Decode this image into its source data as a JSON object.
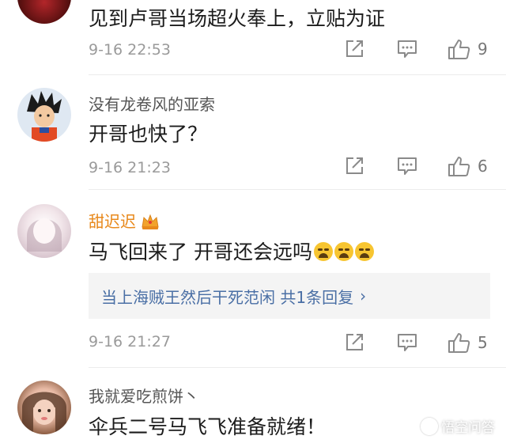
{
  "comments": [
    {
      "name": "",
      "text": "见到卢哥当场超火奉上，立贴为证",
      "time": "9-16 22:53",
      "like_count": "9"
    },
    {
      "name": "没有龙卷风的亚索",
      "text": "开哥也快了？",
      "time": "9-16 21:23",
      "like_count": "6"
    },
    {
      "name": "甜迟迟",
      "text": "马飞回来了 开哥还会远吗",
      "emoji_count": 3,
      "reply_summary": "当上海贼王然后干死范闲  共1条回复",
      "reply_chevron": "›",
      "time": "9-16 21:27",
      "like_count": "5"
    },
    {
      "name": "我就爱吃煎饼丶",
      "text": "伞兵二号马飞飞准备就绪！"
    }
  ],
  "icons": {
    "share": "share-icon",
    "comment": "comment-icon",
    "like": "thumbs-up-icon",
    "badge": "crown-badge-icon",
    "emoji": "crying-emoji-icon"
  },
  "colors": {
    "vip_name": "#e8891c",
    "reply_link": "#4a6fa5",
    "icon_gray": "#8a8a8a"
  },
  "watermark": "悟空问答"
}
